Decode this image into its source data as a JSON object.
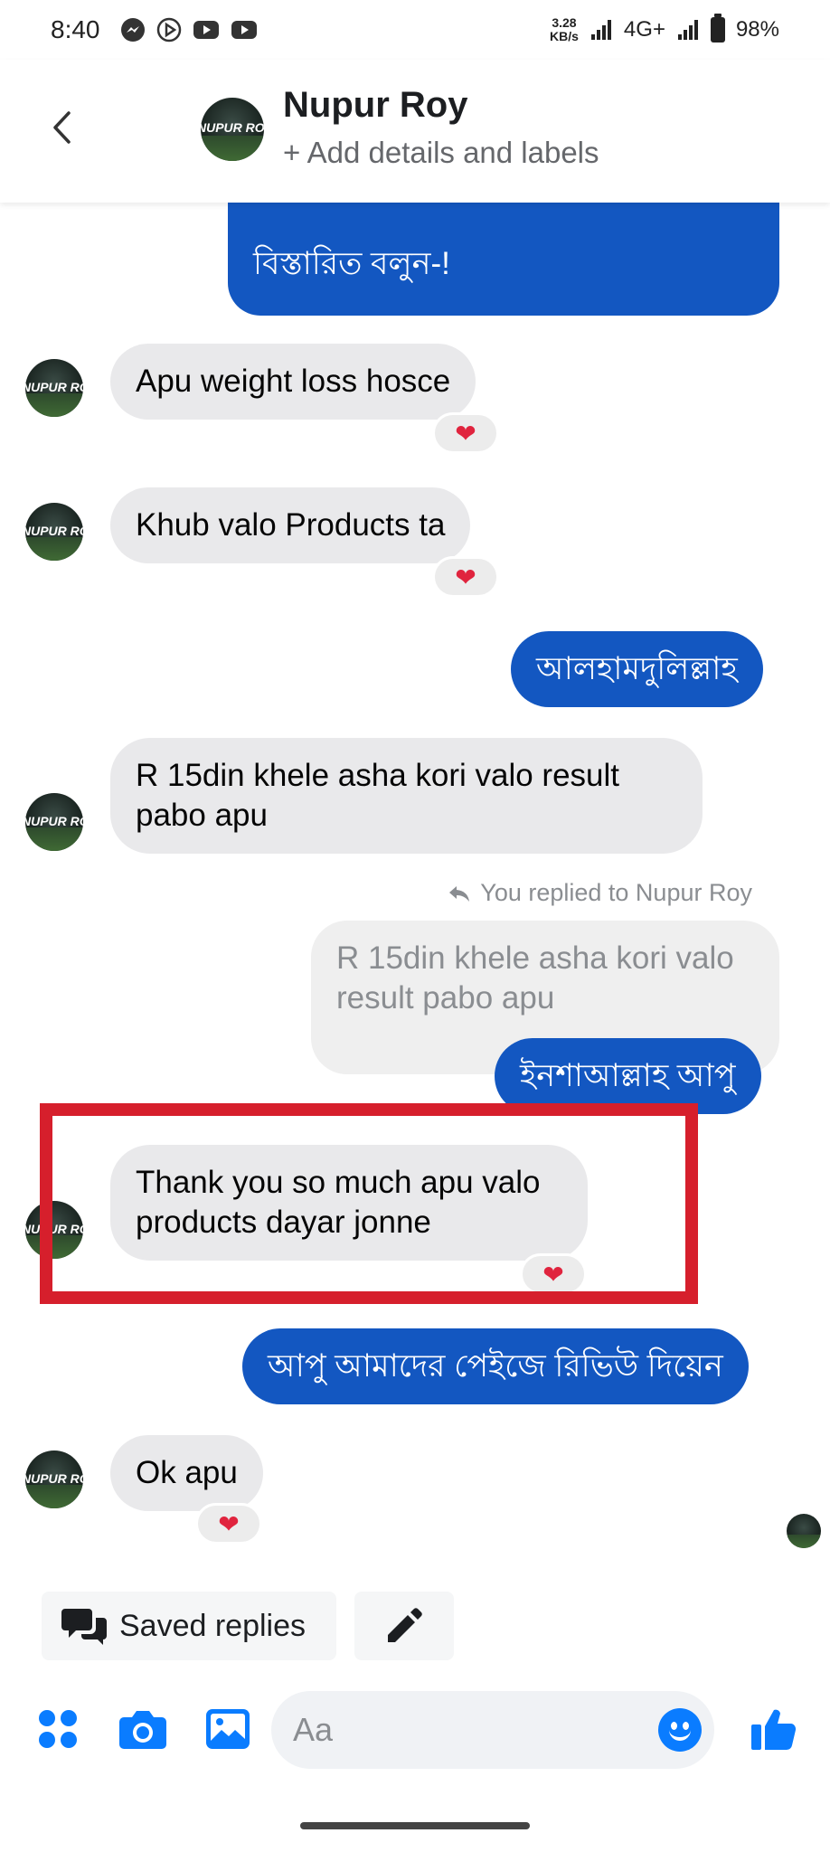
{
  "status_bar": {
    "time": "8:40",
    "net_speed_value": "3.28",
    "net_speed_unit": "KB/s",
    "network": "4G+",
    "battery": "98%",
    "left_icons": [
      "messenger-icon",
      "play-store-icon",
      "youtube-icon",
      "youtube-icon"
    ]
  },
  "header": {
    "back_icon": "chevron-left-icon",
    "contact_name": "Nupur Roy",
    "subtitle": "+ Add details and labels",
    "avatar_text": "NUPUR ROY"
  },
  "messages": [
    {
      "id": "m1",
      "direction": "out",
      "text": "বিস্তারিত বলুন-!"
    },
    {
      "id": "m2",
      "direction": "in",
      "text": "Apu weight loss hosce",
      "reaction": "❤"
    },
    {
      "id": "m3",
      "direction": "in",
      "text": "Khub valo Products  ta",
      "reaction": "❤"
    },
    {
      "id": "m4",
      "direction": "out",
      "text": "আলহামদুলিল্লাহ"
    },
    {
      "id": "m5",
      "direction": "in",
      "text": "R 15din khele asha kori valo result pabo apu"
    },
    {
      "id": "m6",
      "direction": "out",
      "reply_label": "You replied to Nupur Roy",
      "quoted_text": "R 15din khele asha kori valo result pabo apu",
      "text": "ইনশাআল্লাহ আপু"
    },
    {
      "id": "m7",
      "direction": "in",
      "text": "Thank you so much apu valo products dayar jonne",
      "reaction": "❤",
      "highlighted": true
    },
    {
      "id": "m8",
      "direction": "out",
      "text": "আপু আমাদের পেইজে রিভিউ দিয়েন"
    },
    {
      "id": "m9",
      "direction": "in",
      "text": "Ok apu",
      "reaction": "❤"
    }
  ],
  "quick_actions": {
    "saved_replies_label": "Saved replies",
    "edit_icon": "pencil-icon"
  },
  "composer": {
    "placeholder": "Aa",
    "icons": [
      "apps-icon",
      "camera-icon",
      "image-icon",
      "emoji-icon",
      "thumbs-up-icon"
    ]
  },
  "colors": {
    "outgoing_bubble": "#1357c1",
    "incoming_bubble": "#e9e9eb",
    "accent": "#0a7cff",
    "highlight_box": "#d61f2c",
    "heart": "#e0243e"
  }
}
